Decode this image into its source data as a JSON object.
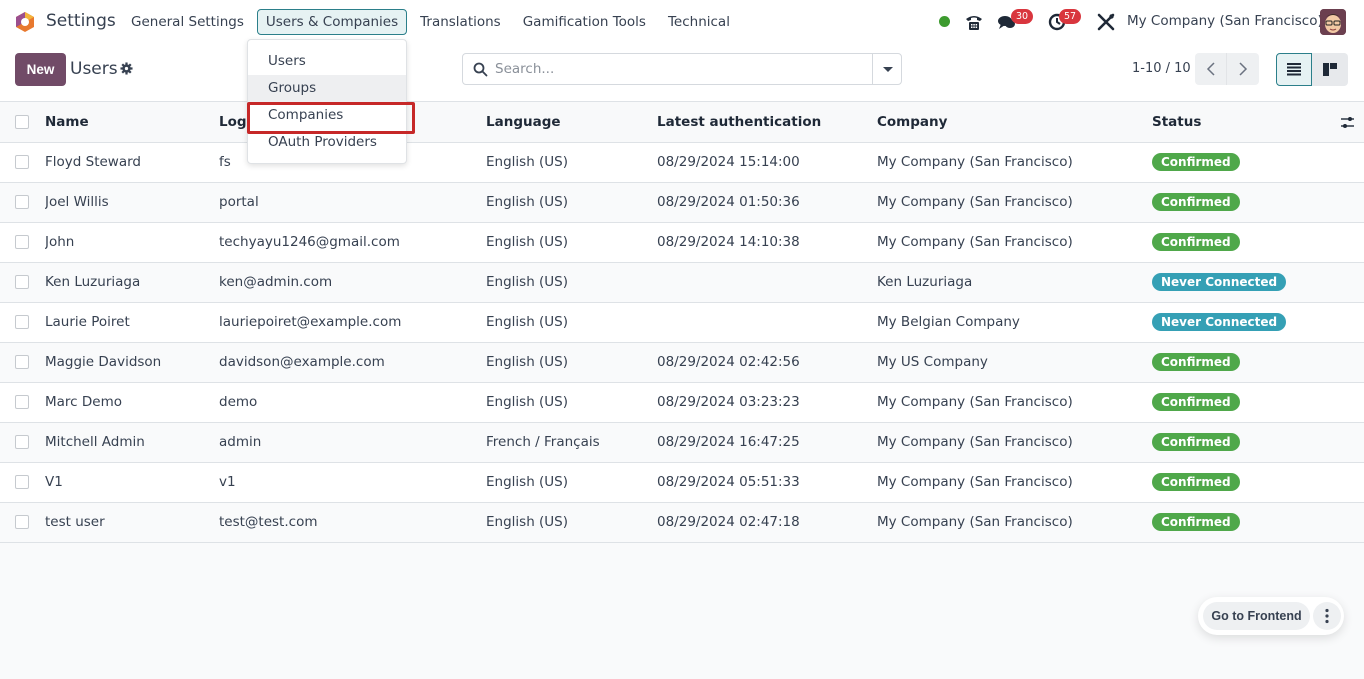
{
  "app": {
    "title": "Settings"
  },
  "nav": {
    "items": [
      {
        "label": "General Settings",
        "active": false
      },
      {
        "label": "Users & Companies",
        "active": true
      },
      {
        "label": "Translations",
        "active": false
      },
      {
        "label": "Gamification Tools",
        "active": false
      },
      {
        "label": "Technical",
        "active": false
      }
    ]
  },
  "systray": {
    "messages_count": "30",
    "activities_count": "57",
    "company": "My Company (San Francisco)"
  },
  "dropdown": {
    "items": [
      {
        "label": "Users"
      },
      {
        "label": "Groups"
      },
      {
        "label": "Companies"
      },
      {
        "label": "OAuth Providers"
      }
    ]
  },
  "control_panel": {
    "new_label": "New",
    "title": "Users",
    "search_placeholder": "Search...",
    "pager": "1-10 / 10"
  },
  "table": {
    "columns": [
      "Name",
      "Login",
      "Language",
      "Latest authentication",
      "Company",
      "Status"
    ],
    "rows": [
      {
        "name": "Floyd Steward",
        "login": "fs",
        "language": "English (US)",
        "latest_auth": "08/29/2024 15:14:00",
        "company": "My Company (San Francisco)",
        "status": "Confirmed"
      },
      {
        "name": "Joel Willis",
        "login": "portal",
        "language": "English (US)",
        "latest_auth": "08/29/2024 01:50:36",
        "company": "My Company (San Francisco)",
        "status": "Confirmed"
      },
      {
        "name": "John",
        "login": "techyayu1246@gmail.com",
        "language": "English (US)",
        "latest_auth": "08/29/2024 14:10:38",
        "company": "My Company (San Francisco)",
        "status": "Confirmed"
      },
      {
        "name": "Ken Luzuriaga",
        "login": "ken@admin.com",
        "language": "English (US)",
        "latest_auth": "",
        "company": "Ken Luzuriaga",
        "status": "Never Connected"
      },
      {
        "name": "Laurie Poiret",
        "login": "lauriepoiret@example.com",
        "language": "English (US)",
        "latest_auth": "",
        "company": "My Belgian Company",
        "status": "Never Connected"
      },
      {
        "name": "Maggie Davidson",
        "login": "davidson@example.com",
        "language": "English (US)",
        "latest_auth": "08/29/2024 02:42:56",
        "company": "My US Company",
        "status": "Confirmed"
      },
      {
        "name": "Marc Demo",
        "login": "demo",
        "language": "English (US)",
        "latest_auth": "08/29/2024 03:23:23",
        "company": "My Company (San Francisco)",
        "status": "Confirmed"
      },
      {
        "name": "Mitchell Admin",
        "login": "admin",
        "language": "French / Français",
        "latest_auth": "08/29/2024 16:47:25",
        "company": "My Company (San Francisco)",
        "status": "Confirmed"
      },
      {
        "name": "V1",
        "login": "v1",
        "language": "English (US)",
        "latest_auth": "08/29/2024 05:51:33",
        "company": "My Company (San Francisco)",
        "status": "Confirmed"
      },
      {
        "name": "test user",
        "login": "test@test.com",
        "language": "English (US)",
        "latest_auth": "08/29/2024 02:47:18",
        "company": "My Company (San Francisco)",
        "status": "Confirmed"
      }
    ]
  },
  "footer": {
    "frontend_label": "Go to Frontend"
  },
  "colors": {
    "brand": "#714b67",
    "accent": "#2b7f8a",
    "confirmed": "#4fa84a",
    "never_connected": "#35a0b5",
    "badge": "#d9363e",
    "highlight": "#c62828"
  }
}
